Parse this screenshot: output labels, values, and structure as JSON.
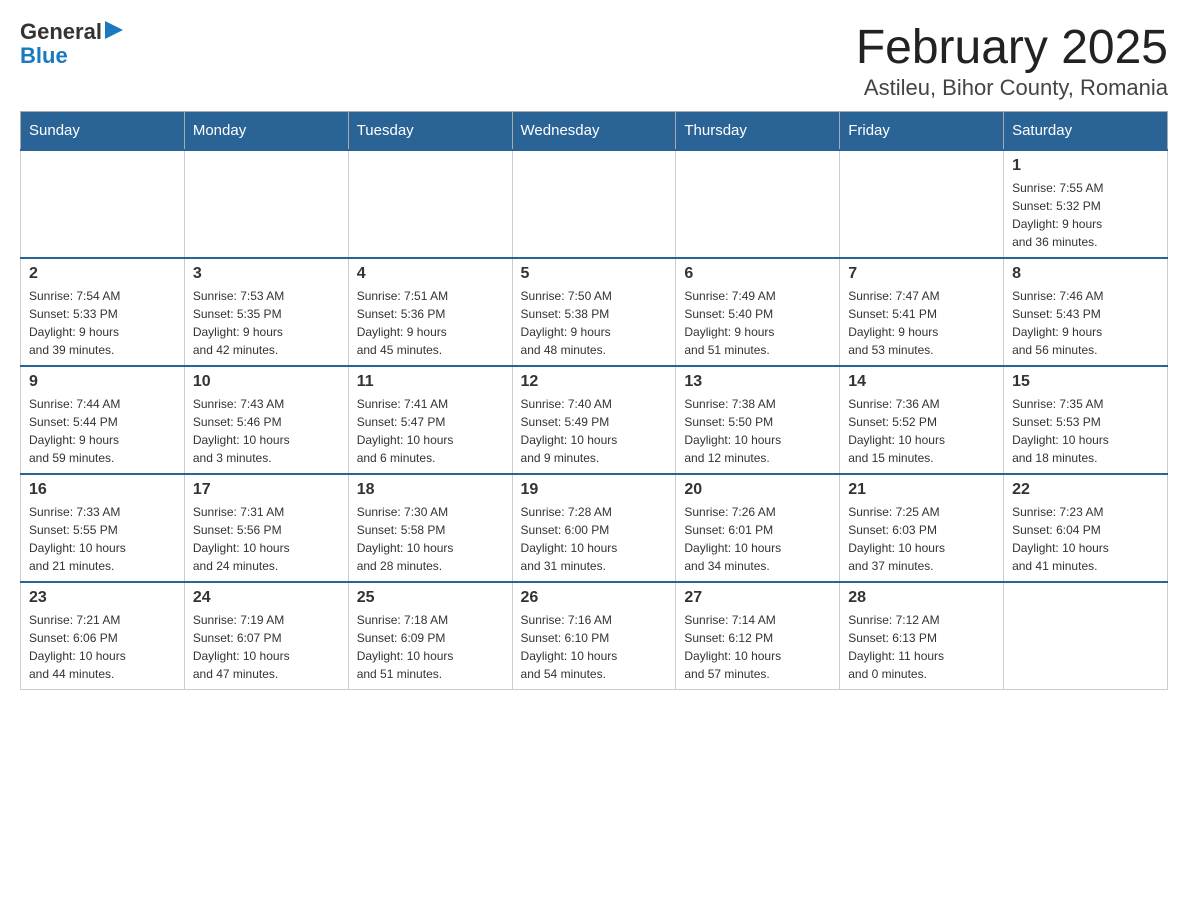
{
  "header": {
    "logo_general": "General",
    "logo_blue": "Blue",
    "title": "February 2025",
    "subtitle": "Astileu, Bihor County, Romania"
  },
  "weekdays": [
    "Sunday",
    "Monday",
    "Tuesday",
    "Wednesday",
    "Thursday",
    "Friday",
    "Saturday"
  ],
  "weeks": [
    [
      {
        "day": "",
        "info": ""
      },
      {
        "day": "",
        "info": ""
      },
      {
        "day": "",
        "info": ""
      },
      {
        "day": "",
        "info": ""
      },
      {
        "day": "",
        "info": ""
      },
      {
        "day": "",
        "info": ""
      },
      {
        "day": "1",
        "info": "Sunrise: 7:55 AM\nSunset: 5:32 PM\nDaylight: 9 hours\nand 36 minutes."
      }
    ],
    [
      {
        "day": "2",
        "info": "Sunrise: 7:54 AM\nSunset: 5:33 PM\nDaylight: 9 hours\nand 39 minutes."
      },
      {
        "day": "3",
        "info": "Sunrise: 7:53 AM\nSunset: 5:35 PM\nDaylight: 9 hours\nand 42 minutes."
      },
      {
        "day": "4",
        "info": "Sunrise: 7:51 AM\nSunset: 5:36 PM\nDaylight: 9 hours\nand 45 minutes."
      },
      {
        "day": "5",
        "info": "Sunrise: 7:50 AM\nSunset: 5:38 PM\nDaylight: 9 hours\nand 48 minutes."
      },
      {
        "day": "6",
        "info": "Sunrise: 7:49 AM\nSunset: 5:40 PM\nDaylight: 9 hours\nand 51 minutes."
      },
      {
        "day": "7",
        "info": "Sunrise: 7:47 AM\nSunset: 5:41 PM\nDaylight: 9 hours\nand 53 minutes."
      },
      {
        "day": "8",
        "info": "Sunrise: 7:46 AM\nSunset: 5:43 PM\nDaylight: 9 hours\nand 56 minutes."
      }
    ],
    [
      {
        "day": "9",
        "info": "Sunrise: 7:44 AM\nSunset: 5:44 PM\nDaylight: 9 hours\nand 59 minutes."
      },
      {
        "day": "10",
        "info": "Sunrise: 7:43 AM\nSunset: 5:46 PM\nDaylight: 10 hours\nand 3 minutes."
      },
      {
        "day": "11",
        "info": "Sunrise: 7:41 AM\nSunset: 5:47 PM\nDaylight: 10 hours\nand 6 minutes."
      },
      {
        "day": "12",
        "info": "Sunrise: 7:40 AM\nSunset: 5:49 PM\nDaylight: 10 hours\nand 9 minutes."
      },
      {
        "day": "13",
        "info": "Sunrise: 7:38 AM\nSunset: 5:50 PM\nDaylight: 10 hours\nand 12 minutes."
      },
      {
        "day": "14",
        "info": "Sunrise: 7:36 AM\nSunset: 5:52 PM\nDaylight: 10 hours\nand 15 minutes."
      },
      {
        "day": "15",
        "info": "Sunrise: 7:35 AM\nSunset: 5:53 PM\nDaylight: 10 hours\nand 18 minutes."
      }
    ],
    [
      {
        "day": "16",
        "info": "Sunrise: 7:33 AM\nSunset: 5:55 PM\nDaylight: 10 hours\nand 21 minutes."
      },
      {
        "day": "17",
        "info": "Sunrise: 7:31 AM\nSunset: 5:56 PM\nDaylight: 10 hours\nand 24 minutes."
      },
      {
        "day": "18",
        "info": "Sunrise: 7:30 AM\nSunset: 5:58 PM\nDaylight: 10 hours\nand 28 minutes."
      },
      {
        "day": "19",
        "info": "Sunrise: 7:28 AM\nSunset: 6:00 PM\nDaylight: 10 hours\nand 31 minutes."
      },
      {
        "day": "20",
        "info": "Sunrise: 7:26 AM\nSunset: 6:01 PM\nDaylight: 10 hours\nand 34 minutes."
      },
      {
        "day": "21",
        "info": "Sunrise: 7:25 AM\nSunset: 6:03 PM\nDaylight: 10 hours\nand 37 minutes."
      },
      {
        "day": "22",
        "info": "Sunrise: 7:23 AM\nSunset: 6:04 PM\nDaylight: 10 hours\nand 41 minutes."
      }
    ],
    [
      {
        "day": "23",
        "info": "Sunrise: 7:21 AM\nSunset: 6:06 PM\nDaylight: 10 hours\nand 44 minutes."
      },
      {
        "day": "24",
        "info": "Sunrise: 7:19 AM\nSunset: 6:07 PM\nDaylight: 10 hours\nand 47 minutes."
      },
      {
        "day": "25",
        "info": "Sunrise: 7:18 AM\nSunset: 6:09 PM\nDaylight: 10 hours\nand 51 minutes."
      },
      {
        "day": "26",
        "info": "Sunrise: 7:16 AM\nSunset: 6:10 PM\nDaylight: 10 hours\nand 54 minutes."
      },
      {
        "day": "27",
        "info": "Sunrise: 7:14 AM\nSunset: 6:12 PM\nDaylight: 10 hours\nand 57 minutes."
      },
      {
        "day": "28",
        "info": "Sunrise: 7:12 AM\nSunset: 6:13 PM\nDaylight: 11 hours\nand 0 minutes."
      },
      {
        "day": "",
        "info": ""
      }
    ]
  ]
}
